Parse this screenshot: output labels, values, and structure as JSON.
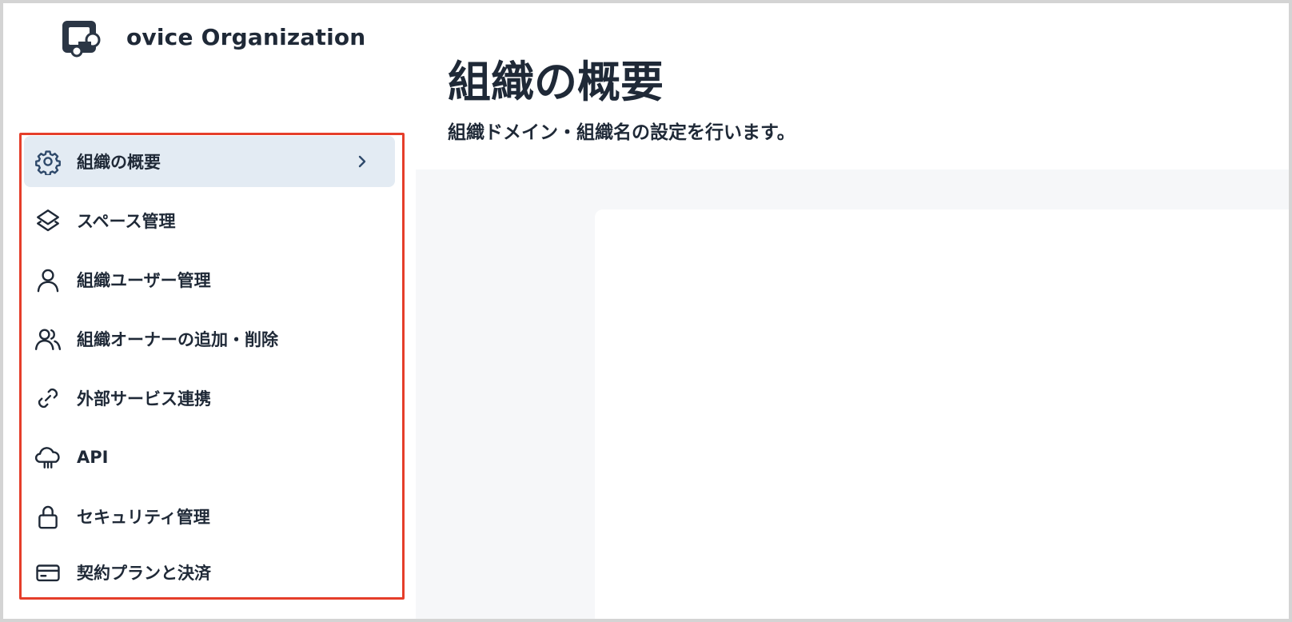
{
  "brand": {
    "name": "ovice Organization",
    "logo_icon": "ovice-logo-icon"
  },
  "sidebar": {
    "items": [
      {
        "label": "組織の概要",
        "icon": "gear-icon",
        "active": true
      },
      {
        "label": "スペース管理",
        "icon": "layers-icon",
        "active": false
      },
      {
        "label": "組織ユーザー管理",
        "icon": "user-icon",
        "active": false
      },
      {
        "label": "組織オーナーの追加・削除",
        "icon": "users-icon",
        "active": false
      },
      {
        "label": "外部サービス連携",
        "icon": "link-icon",
        "active": false
      },
      {
        "label": "API",
        "icon": "cloud-icon",
        "active": false
      },
      {
        "label": "セキュリティ管理",
        "icon": "lock-icon",
        "active": false
      },
      {
        "label": "契約プランと決済",
        "icon": "credit-card-icon",
        "active": false
      }
    ]
  },
  "main": {
    "title": "組織の概要",
    "subtitle": "組織ドメイン・組織名の設定を行います。"
  },
  "colors": {
    "active_bg": "#e3ebf3",
    "highlight_border": "#e53e2a",
    "content_bg": "#f6f7f9",
    "text": "#1f2937"
  }
}
